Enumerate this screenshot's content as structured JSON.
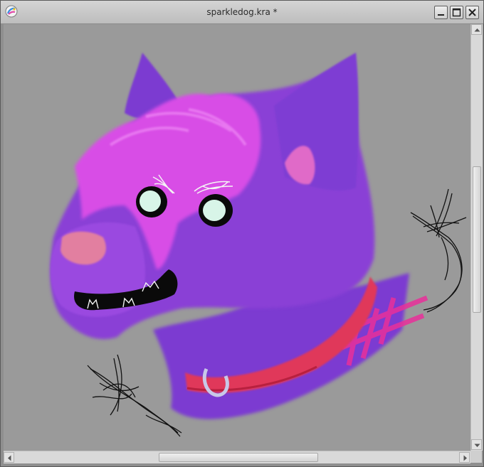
{
  "window": {
    "title": "sparkledog.kra *",
    "buttons": {
      "minimize": "minimize-icon",
      "maximize": "maximize-icon",
      "close": "close-icon"
    }
  },
  "canvas": {
    "background": "#9a9a9a",
    "artwork": "sparkle-dog-drawing"
  },
  "colors": {
    "fur": "#8a3fd6",
    "hair": "#d84de6",
    "collar": "#e0385a",
    "eyes": "#d8f5e8"
  }
}
